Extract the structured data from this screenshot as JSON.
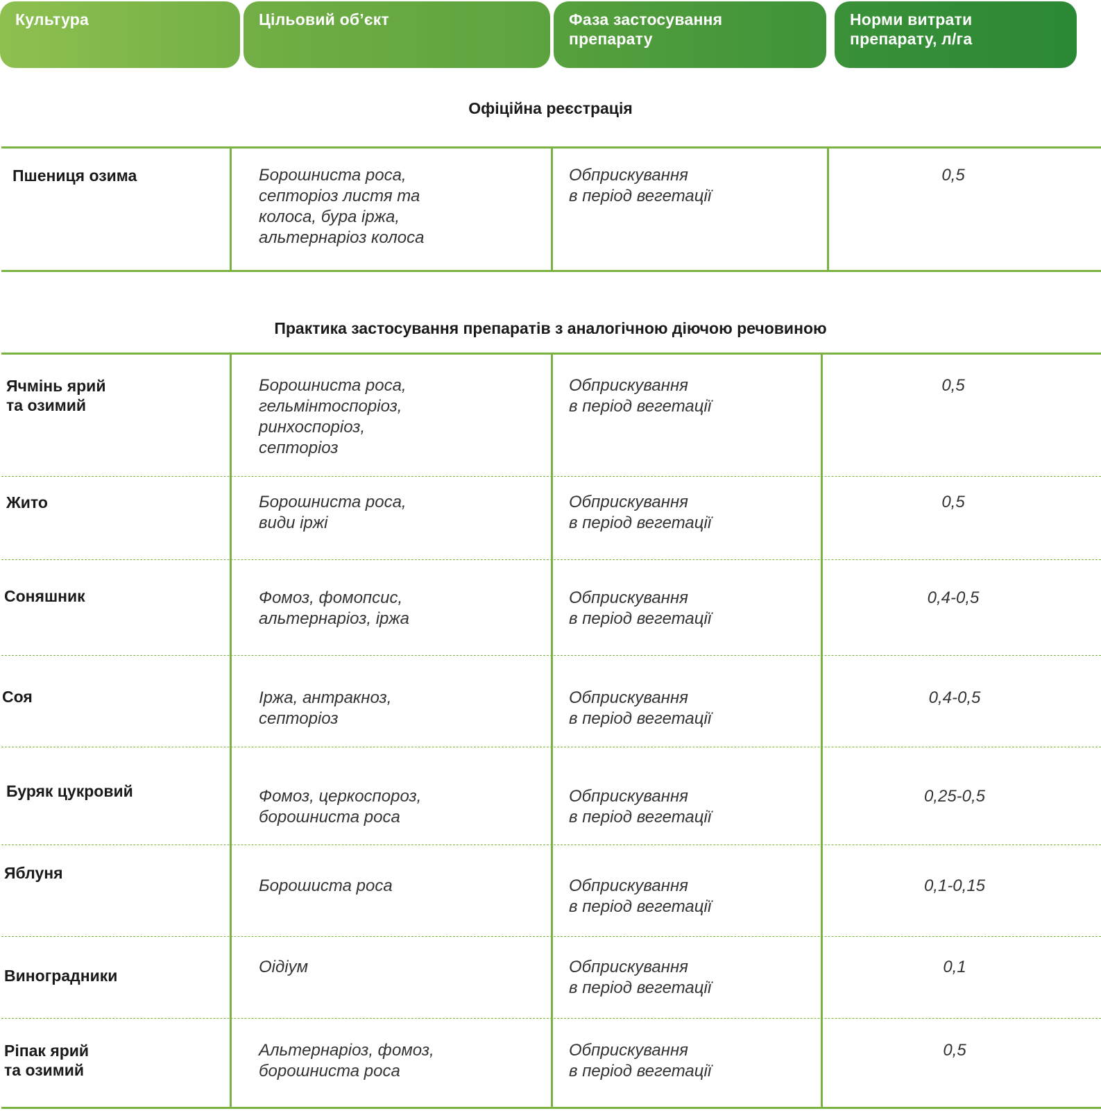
{
  "headers": [
    "Культура",
    "Цільовий об’єкт",
    "Фаза застосування\nпрепарату",
    "Норми витрати\nпрепарату, л/га"
  ],
  "sections": [
    {
      "title": "Офіційна реєстрація",
      "rows": [
        {
          "crop": "Пшениця озима",
          "target": "Борошниста роса,\nсепторіоз листя та\nколоса, бура іржа,\nальтернаріоз колоса",
          "phase": "Обприскування\nв період вегетації",
          "rate": "0,5"
        }
      ]
    },
    {
      "title": "Практика застосування препаратів з аналогічною діючою речовиною",
      "rows": [
        {
          "crop": "Ячмінь ярий\nта озимий",
          "target": "Борошниста роса,\nгельмінтоспоріоз,\nринхоспоріоз,\nсепторіоз",
          "phase": "Обприскування\nв період вегетації",
          "rate": "0,5"
        },
        {
          "crop": "Жито",
          "target": "Борошниста роса,\nвиди іржі",
          "phase": "Обприскування\nв період вегетації",
          "rate": "0,5"
        },
        {
          "crop": "Соняшник",
          "target": "Фомоз, фомопсис,\nальтернаріоз, іржа",
          "phase": "Обприскування\nв період вегетації",
          "rate": "0,4-0,5"
        },
        {
          "crop": "Соя",
          "target": "Іржа, антракноз,\nсепторіоз",
          "phase": "Обприскування\nв період вегетації",
          "rate": "0,4-0,5"
        },
        {
          "crop": "Буряк цукровий",
          "target": "Фомоз, церкоспороз,\nборошниста роса",
          "phase": "Обприскування\nв період вегетації",
          "rate": "0,25-0,5"
        },
        {
          "crop": "Яблуня",
          "target": "Борошиста роса",
          "phase": "Обприскування\nв період вегетації",
          "rate": "0,1-0,15"
        },
        {
          "crop": "Виноградники",
          "target": "Оідіум",
          "phase": "Обприскування\nв період вегетації",
          "rate": "0,1"
        },
        {
          "crop": "Ріпак ярий\nта озимий",
          "target": "Альтернаріоз, фомоз,\nборошниста роса",
          "phase": "Обприскування\nв період вегетації",
          "rate": "0,5"
        }
      ]
    }
  ],
  "colors": {
    "accent_green": "#7ab342",
    "header_gradient_start": "#8ec050",
    "header_gradient_end": "#2b8835",
    "header_text": "#ffffff"
  }
}
